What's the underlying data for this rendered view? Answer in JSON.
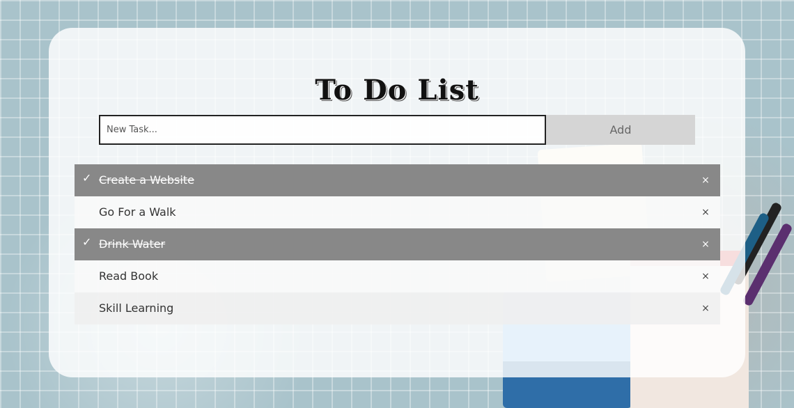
{
  "app": {
    "title": "To Do List"
  },
  "input": {
    "placeholder": "New Task...",
    "value": ""
  },
  "add_button": {
    "label": "Add"
  },
  "tasks": [
    {
      "label": "Create a Website",
      "checked": true
    },
    {
      "label": "Go For a Walk",
      "checked": false
    },
    {
      "label": "Drink Water",
      "checked": true
    },
    {
      "label": "Read Book",
      "checked": false
    },
    {
      "label": "Skill Learning",
      "checked": false
    }
  ],
  "icons": {
    "check": "check-icon",
    "close": "close-icon"
  },
  "colors": {
    "checked_row": "#888888",
    "add_button_bg": "#d5d5d5",
    "title": "#111111"
  }
}
